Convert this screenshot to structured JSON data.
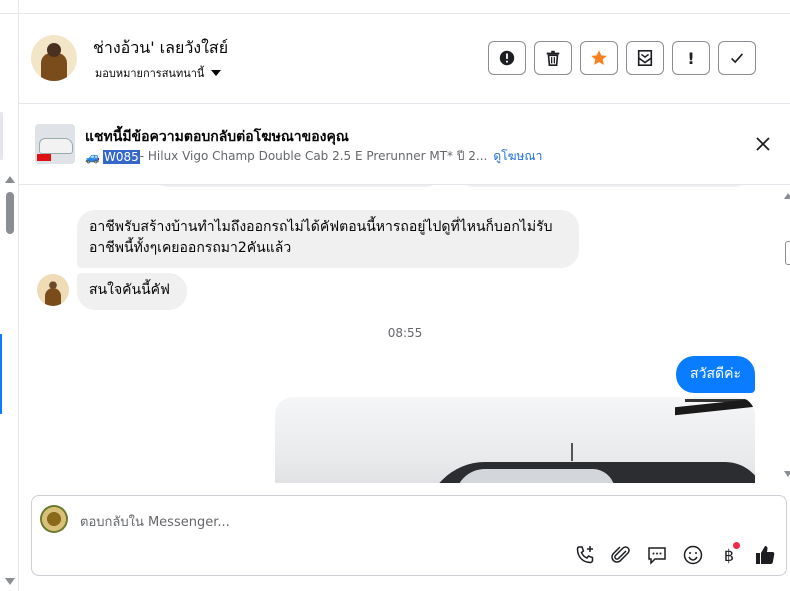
{
  "header": {
    "contact_name": "ช่างอ้วน' เลยวังใสย์",
    "assign_label": "มอบหมายการสนทนานี้",
    "actions": [
      {
        "name": "mark-spam-button",
        "icon": "alert-circle-icon"
      },
      {
        "name": "delete-button",
        "icon": "trash-icon"
      },
      {
        "name": "star-button",
        "icon": "star-icon"
      },
      {
        "name": "mark-unread-button",
        "icon": "mail-icon"
      },
      {
        "name": "follow-up-button",
        "icon": "exclamation-icon",
        "text": "!"
      },
      {
        "name": "mark-done-button",
        "icon": "check-icon"
      }
    ],
    "accent_star": "#f5821f"
  },
  "ad_banner": {
    "title": "แชทนี้มีข้อความตอบกลับต่อโฆษณาของคุณ",
    "emoji": "🚙",
    "code": "W085",
    "description": "- Hilux Vigo Champ Double Cab 2.5 E Prerunner MT* ปี 2...",
    "link_label": "ดูโฆษณา"
  },
  "conversation": {
    "messages": [
      {
        "direction": "in",
        "text": "อาชีพรับสร้างบ้านทำไมถึงออกรถไม่ได้คัฟตอนนี้หารถอยู่ไปดูที่ไหนก็บอกไม่รับอาชีพนี้ทั้งๆเคยออกรถมา2คันแล้ว"
      },
      {
        "direction": "in",
        "text": "สนใจคันนี้คัฟ"
      },
      {
        "direction": "out",
        "text": "สวัสดีค่ะ"
      }
    ],
    "timestamp": "08:55",
    "outgoing_color": "#0a7cff"
  },
  "composer": {
    "placeholder": "ตอบกลับใน Messenger...",
    "tools": [
      "call-add-icon",
      "paperclip-icon",
      "chat-bubble-icon",
      "smiley-icon",
      "baht-icon",
      "thumbs-up-icon"
    ],
    "baht_symbol": "฿"
  }
}
